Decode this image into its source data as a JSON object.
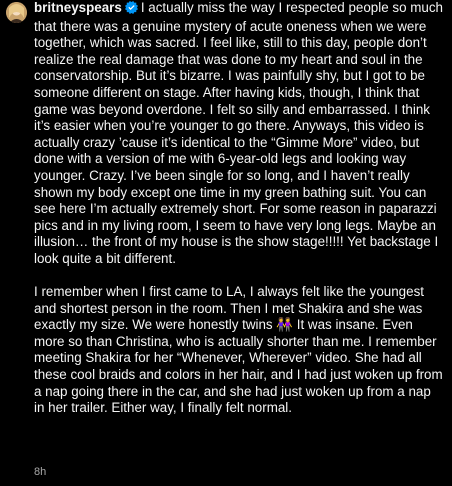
{
  "post": {
    "username": "britneyspears",
    "verified": true,
    "accent_color": "#0095f6",
    "caption_paragraphs": [
      "I actually miss the way I respected people so much that there was a genuine mystery of acute oneness when we were together, which was sacred. I feel like, still to this day, people don’t realize the real damage that was done to my heart and soul in the conservatorship. But it’s bizarre. I was painfully shy, but I got to be someone different on stage. After having kids, though, I think that game was beyond overdone. I felt so silly and embarrassed. I think it’s easier when you’re younger to go there. Anyways, this video is actually crazy ’cause it’s identical to the “Gimme More” video, but done with a version of me with 6-year-old legs and looking way younger.  Crazy. I’ve been single for so long, and I haven’t really shown my body except one time in my green bathing suit. You can see here I’m actually extremely short. For some reason in paparazzi pics and in my living room, I seem to have very long legs. Maybe an illusion… the front of my house is the show stage!!!!! Yet backstage I look quite a bit different.",
      "I remember when I first came to LA, I always felt like the youngest and shortest person in the room. Then I met Shakira and she was exactly my size. We were honestly twins 👭 It was insane. Even more so than Christina, who is actually shorter than me. I remember meeting Shakira for her “Whenever, Wherever” video. She had all these cool braids and colors in her hair, and I had just woken up from a nap going there in the car, and she had just woken up from a nap in her trailer. Either way, I finally felt normal."
    ],
    "timestamp": "8h"
  }
}
